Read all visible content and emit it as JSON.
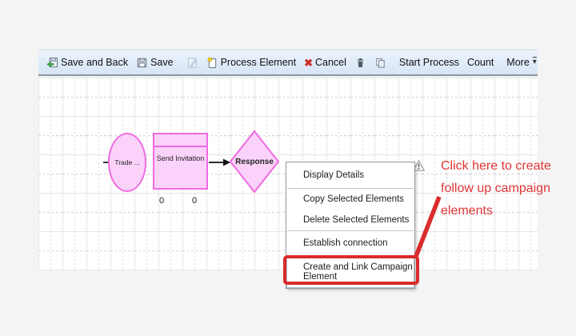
{
  "toolbar": {
    "save_and_back": "Save and Back",
    "save": "Save",
    "process_element": "Process Element",
    "cancel": "Cancel",
    "start_process": "Start Process",
    "count": "Count",
    "more": "More"
  },
  "diagram": {
    "start_node": "Trade ...",
    "step_node": "Send Invitation",
    "decision_node": "Response",
    "counters": [
      "0",
      "0"
    ]
  },
  "context_menu": {
    "items": [
      "Display Details",
      "Copy Selected Elements",
      "Delete Selected Elements",
      "Establish connection",
      "Create and Link Campaign Element"
    ],
    "highlighted_item": "Create and Link Campaign Element"
  },
  "annotation": {
    "lines": [
      "Click here to create",
      "follow up campaign",
      "elements"
    ]
  },
  "icons": {
    "save_back": "floppy-disk-with-green-back-arrow",
    "save": "floppy-disk",
    "edit": "pencil-on-page (disabled)",
    "process_element": "page-with-yellow-star",
    "cancel": "✖",
    "trash": "trash-can",
    "copy": "two-pages",
    "more_caret": "▾",
    "warning": "!"
  },
  "colors": {
    "toolbar_bg": "#dce9f7",
    "shape_fill": "#fbd2fa",
    "shape_border": "#ef6be1",
    "highlight_red": "#d92b2b",
    "annotation_red": "#e03535",
    "grid_line": "#e7e7e7"
  }
}
